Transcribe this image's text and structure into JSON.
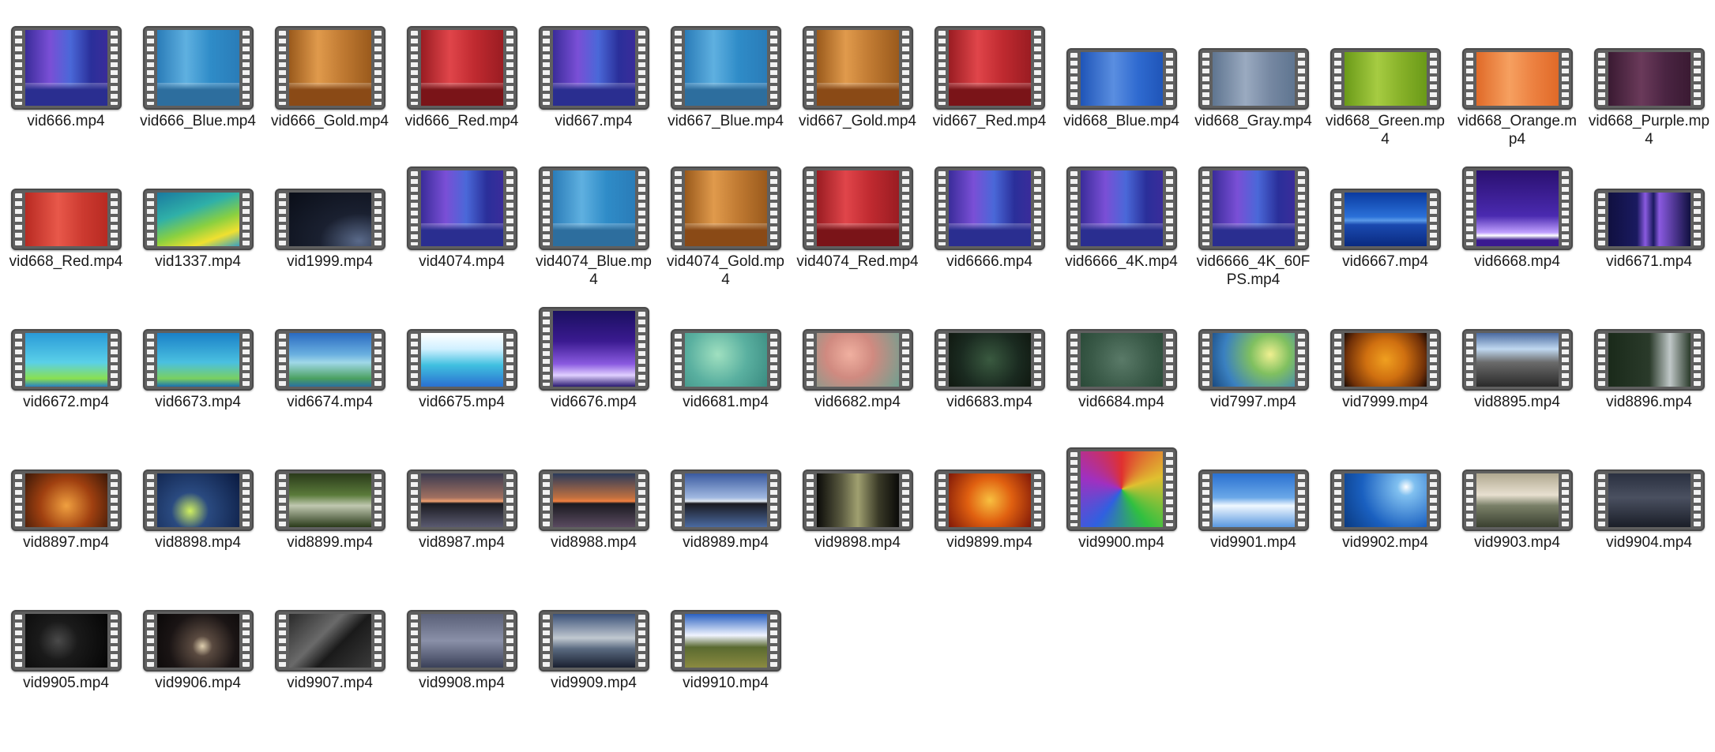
{
  "files": [
    {
      "name": "vid666.mp4",
      "thumb": "linear-gradient(90deg,#3a2c9a,#7a4fd6 30%,#4a68d8 55%,#2a2f9a 80%,#3a2c9a)",
      "tall": true,
      "floor": "#2a2e90"
    },
    {
      "name": "vid666_Blue.mp4",
      "thumb": "linear-gradient(90deg,#2a7cb8,#5fb0e0 35%,#2f8cc8 65%,#2a7cb8)",
      "tall": true,
      "floor": "#2d6e9e"
    },
    {
      "name": "vid666_Gold.mp4",
      "thumb": "linear-gradient(90deg,#9a5a1c,#e09a4c 35%,#c07a32 65%,#9a5a1c)",
      "tall": true,
      "floor": "#8a4a16"
    },
    {
      "name": "vid666_Red.mp4",
      "thumb": "linear-gradient(90deg,#9a1c22,#e0454a 35%,#c02a30 65%,#9a1c22)",
      "tall": true,
      "floor": "#7a1418"
    },
    {
      "name": "vid667.mp4",
      "thumb": "linear-gradient(90deg,#3a2c9a,#7a4fd6 30%,#4a68d8 55%,#2a2f9a 80%,#3a2c9a)",
      "tall": true,
      "floor": "#2a2e90"
    },
    {
      "name": "vid667_Blue.mp4",
      "thumb": "linear-gradient(90deg,#2a7cb8,#5fb0e0 35%,#2f8cc8 65%,#2a7cb8)",
      "tall": true,
      "floor": "#2d6e9e"
    },
    {
      "name": "vid667_Gold.mp4",
      "thumb": "linear-gradient(90deg,#9a5a1c,#e09a4c 35%,#c07a32 65%,#9a5a1c)",
      "tall": true,
      "floor": "#8a4a16"
    },
    {
      "name": "vid667_Red.mp4",
      "thumb": "linear-gradient(90deg,#9a1c22,#e0454a 35%,#c02a30 65%,#9a1c22)",
      "tall": true,
      "floor": "#7a1418"
    },
    {
      "name": "vid668_Blue.mp4",
      "thumb": "linear-gradient(90deg,#1f55b8,#5a8ee0 40%,#2f6ad0 70%,#1f55b8)",
      "tall": false,
      "floor": ""
    },
    {
      "name": "vid668_Gray.mp4",
      "thumb": "linear-gradient(90deg,#5f7590,#9aaac0 40%,#7688a2 70%,#5f7590)",
      "tall": false,
      "floor": ""
    },
    {
      "name": "vid668_Green.mp4",
      "thumb": "linear-gradient(90deg,#6a9a18,#a6cc42 40%,#86b028 70%,#6a9a18)",
      "tall": false,
      "floor": ""
    },
    {
      "name": "vid668_Orange.mp4",
      "thumb": "linear-gradient(90deg,#e06a28,#f6a060 40%,#ec8040 70%,#e06a28)",
      "tall": false,
      "floor": ""
    },
    {
      "name": "vid668_Purple.mp4",
      "thumb": "linear-gradient(90deg,#3a1a32,#6a3a5a 40%,#4a2442 70%,#3a1a32)",
      "tall": false,
      "floor": ""
    },
    {
      "name": "vid668_Red.mp4",
      "thumb": "linear-gradient(90deg,#b82a22,#e8584a 40%,#cc3a30 70%,#b82a22)",
      "tall": false,
      "floor": ""
    },
    {
      "name": "vid1337.mp4",
      "thumb": "linear-gradient(160deg,#1a7aa0 0%,#2fb0a8 35%,#8ad040 60%,#f0e030 80%,#3aa0c0 100%)",
      "tall": false,
      "floor": ""
    },
    {
      "name": "vid1999.mp4",
      "thumb": "radial-gradient(ellipse at 85% 90%,#5a6a8a 0%,#1a2030 40%,#0a0e18 100%)",
      "tall": false,
      "floor": ""
    },
    {
      "name": "vid4074.mp4",
      "thumb": "linear-gradient(90deg,#3a2c9a,#7a4fd6 30%,#4a68d8 55%,#2a2f9a 80%,#3a2c9a)",
      "tall": true,
      "floor": "#2a2e90"
    },
    {
      "name": "vid4074_Blue.mp4",
      "thumb": "linear-gradient(90deg,#2a7cb8,#5fb0e0 35%,#2f8cc8 65%,#2a7cb8)",
      "tall": true,
      "floor": "#2d6e9e"
    },
    {
      "name": "vid4074_Gold.mp4",
      "thumb": "linear-gradient(90deg,#9a5a1c,#e09a4c 35%,#c07a32 65%,#9a5a1c)",
      "tall": true,
      "floor": "#8a4a16"
    },
    {
      "name": "vid4074_Red.mp4",
      "thumb": "linear-gradient(90deg,#9a1c22,#e0454a 35%,#c02a30 65%,#9a1c22)",
      "tall": true,
      "floor": "#7a1418"
    },
    {
      "name": "vid6666.mp4",
      "thumb": "linear-gradient(90deg,#3a2c9a,#7a4fd6 30%,#4a68d8 55%,#2a2f9a 80%,#3a2c9a)",
      "tall": true,
      "floor": "#2a2e90"
    },
    {
      "name": "vid6666_4K.mp4",
      "thumb": "linear-gradient(90deg,#3a2c9a,#7a4fd6 30%,#4a68d8 55%,#2a2f9a 80%,#3a2c9a)",
      "tall": true,
      "floor": "#2a2e90"
    },
    {
      "name": "vid6666_4K_60FPS.mp4",
      "thumb": "linear-gradient(90deg,#3a2c9a,#7a4fd6 30%,#4a68d8 55%,#2a2f9a 80%,#3a2c9a)",
      "tall": true,
      "floor": "#2a2e90"
    },
    {
      "name": "vid6667.mp4",
      "thumb": "linear-gradient(180deg,#0a3aa0 0%,#2a70d8 45%,#5a9ae8 52%,#1a4ab0 60%,#0a2a80 100%)",
      "tall": false,
      "floor": ""
    },
    {
      "name": "vid6668.mp4",
      "thumb": "linear-gradient(180deg,#2a1070 0%,#4a2ab0 60%,#c0a0ff 82%,#ffffff 86%,#3a1a90 92%)",
      "tall": true,
      "floor": ""
    },
    {
      "name": "vid6671.mp4",
      "thumb": "linear-gradient(90deg,#101040,#1a1a60 35%,#8a5ae0 45%,#1a1a60 55%,#8a5ae0 62%,#101040)",
      "tall": false,
      "floor": ""
    },
    {
      "name": "vid6672.mp4",
      "thumb": "linear-gradient(180deg,#2a9ad8 0%,#5ad0e8 55%,#8ae050 85%,#2a80c0 100%)",
      "tall": false,
      "floor": ""
    },
    {
      "name": "vid6673.mp4",
      "thumb": "linear-gradient(180deg,#1a80c8 0%,#4ac0e0 55%,#7ad060 85%,#1a70b0 100%)",
      "tall": false,
      "floor": ""
    },
    {
      "name": "vid6674.mp4",
      "thumb": "linear-gradient(180deg,#2a6ac0 0%,#6ab0e0 40%,#a0d8e8 55%,#4aa060 85%,#2a70a0 100%)",
      "tall": false,
      "floor": ""
    },
    {
      "name": "vid6675.mp4",
      "thumb": "linear-gradient(180deg,#ffffff 0%,#d0f0ff 30%,#40c0e0 60%,#2a70d0 100%)",
      "tall": false,
      "floor": ""
    },
    {
      "name": "vid6676.mp4",
      "thumb": "linear-gradient(180deg,#1a1060 0%,#3a1a90 40%,#8a5ae0 70%,#e0d0ff 85%,#2a1a70 100%)",
      "tall": true,
      "floor": ""
    },
    {
      "name": "vid6681.mp4",
      "thumb": "radial-gradient(circle at 40% 40%,#a0e0c0 0%,#5ab0a0 50%,#3a8a80 100%)",
      "tall": false,
      "floor": ""
    },
    {
      "name": "vid6682.mp4",
      "thumb": "radial-gradient(circle at 40% 40%,#f0b0a0 0%,#d08a80 40%,#70a090 100%)",
      "tall": false,
      "floor": ""
    },
    {
      "name": "vid6683.mp4",
      "thumb": "radial-gradient(circle at 50% 50%,#3a5a40 0%,#1a2a20 60%,#101810 100%)",
      "tall": false,
      "floor": ""
    },
    {
      "name": "vid6684.mp4",
      "thumb": "radial-gradient(circle at 50% 50%,#5a7a68 0%,#3a5a48 60%,#2a4a38 100%)",
      "tall": false,
      "floor": ""
    },
    {
      "name": "vid7997.mp4",
      "thumb": "radial-gradient(circle at 70% 40%,#f0f090 0%,#80c060 30%,#3a80c0 70%,#1a4a80 100%)",
      "tall": false,
      "floor": ""
    },
    {
      "name": "vid7999.mp4",
      "thumb": "radial-gradient(circle at 50% 50%,#f0a020 0%,#d07010 40%,#703008 80%,#1a0a04 100%)",
      "tall": false,
      "floor": ""
    },
    {
      "name": "vid8895.mp4",
      "thumb": "linear-gradient(180deg,#4a6aa0 0%,#c0d8f0 30%,#6a6a6a 55%,#2a2a2a 100%)",
      "tall": false,
      "floor": ""
    },
    {
      "name": "vid8896.mp4",
      "thumb": "linear-gradient(90deg,#1a2a1a 0%,#2a3a2a 50%,#c0c8c8 75%,#2a3a2a 100%)",
      "tall": false,
      "floor": ""
    },
    {
      "name": "vid8897.mp4",
      "thumb": "radial-gradient(circle at 50% 60%,#f0a040 0%,#a04010 50%,#3a1808 100%)",
      "tall": false,
      "floor": ""
    },
    {
      "name": "vid8898.mp4",
      "thumb": "radial-gradient(circle at 40% 70%,#d0f060 0%,#2a4a80 30%,#0a1a40 100%)",
      "tall": false,
      "floor": ""
    },
    {
      "name": "vid8899.mp4",
      "thumb": "linear-gradient(180deg,#2a3a1a 0%,#5a7a3a 40%,#c0c8b0 60%,#2a3a1a 100%)",
      "tall": false,
      "floor": ""
    },
    {
      "name": "vid8987.mp4",
      "thumb": "linear-gradient(180deg,#3a3a50 0%,#a07060 45%,#f0a070 52%,#1a1a20 56%,#5a5a70 100%)",
      "tall": false,
      "floor": ""
    },
    {
      "name": "vid8988.mp4",
      "thumb": "linear-gradient(180deg,#2a3a5a 0%,#c07040 45%,#f08040 52%,#1a1a20 56%,#5a4a60 100%)",
      "tall": false,
      "floor": ""
    },
    {
      "name": "vid8989.mp4",
      "thumb": "linear-gradient(180deg,#3a5aa0 0%,#a0b8e0 45%,#e0e8f0 52%,#1a1a20 56%,#4a6aa0 100%)",
      "tall": false,
      "floor": ""
    },
    {
      "name": "vid9898.mp4",
      "thumb": "linear-gradient(90deg,#0a0a08 0%,#5a5a40 30%,#a0a070 50%,#3a3a28 75%,#0a0a08 100%)",
      "tall": false,
      "floor": ""
    },
    {
      "name": "vid9899.mp4",
      "thumb": "radial-gradient(circle at 50% 50%,#f8c040 0%,#e06010 45%,#801808 100%)",
      "tall": false,
      "floor": ""
    },
    {
      "name": "vid9900.mp4",
      "thumb": "conic-gradient(from 0deg,#e03030,#e0c030,#30c040,#3060e0,#a030c0,#e03030)",
      "tall": true,
      "floor": ""
    },
    {
      "name": "vid9901.mp4",
      "thumb": "linear-gradient(180deg,#2a70d0 0%,#6aa8e8 45%,#f0f8ff 60%,#5a98e0 100%)",
      "tall": false,
      "floor": ""
    },
    {
      "name": "vid9902.mp4",
      "thumb": "radial-gradient(circle at 75% 25%,#ffffff 0%,#80c0f0 12%,#1a60c0 60%,#0a3a80 100%)",
      "tall": false,
      "floor": ""
    },
    {
      "name": "vid9903.mp4",
      "thumb": "linear-gradient(180deg,#b0a890 0%,#e8e0d0 40%,#7a8068 60%,#3a4030 100%)",
      "tall": false,
      "floor": ""
    },
    {
      "name": "vid9904.mp4",
      "thumb": "linear-gradient(180deg,#2a3040 0%,#4a5060 45%,#1a1e28 100%)",
      "tall": false,
      "floor": ""
    },
    {
      "name": "vid9905.mp4",
      "thumb": "radial-gradient(circle at 40% 50%,#4a4a4a 0%,#1a1a1a 35%,#050505 100%)",
      "tall": false,
      "floor": ""
    },
    {
      "name": "vid9906.mp4",
      "thumb": "radial-gradient(circle at 55% 60%,#e0d0b0 0%,#5a4a40 18%,#1a1414 60%,#0a0808 100%)",
      "tall": false,
      "floor": ""
    },
    {
      "name": "vid9907.mp4",
      "thumb": "linear-gradient(135deg,#2a2a2a 0%,#6a6a6a 40%,#1a1a1a 60%,#3a3a3a 100%)",
      "tall": false,
      "floor": ""
    },
    {
      "name": "vid9908.mp4",
      "thumb": "linear-gradient(180deg,#5a6078 0%,#8a90a8 50%,#3a4058 100%)",
      "tall": false,
      "floor": ""
    },
    {
      "name": "vid9909.mp4",
      "thumb": "linear-gradient(180deg,#3a5078 0%,#c0c8d0 45%,#5a6a80 65%,#1a2030 100%)",
      "tall": false,
      "floor": ""
    },
    {
      "name": "vid9910.mp4",
      "thumb": "linear-gradient(180deg,#2a60c0 0%,#f0f4ff 40%,#5a6a30 62%,#8a8a40 100%)",
      "tall": false,
      "floor": ""
    }
  ]
}
